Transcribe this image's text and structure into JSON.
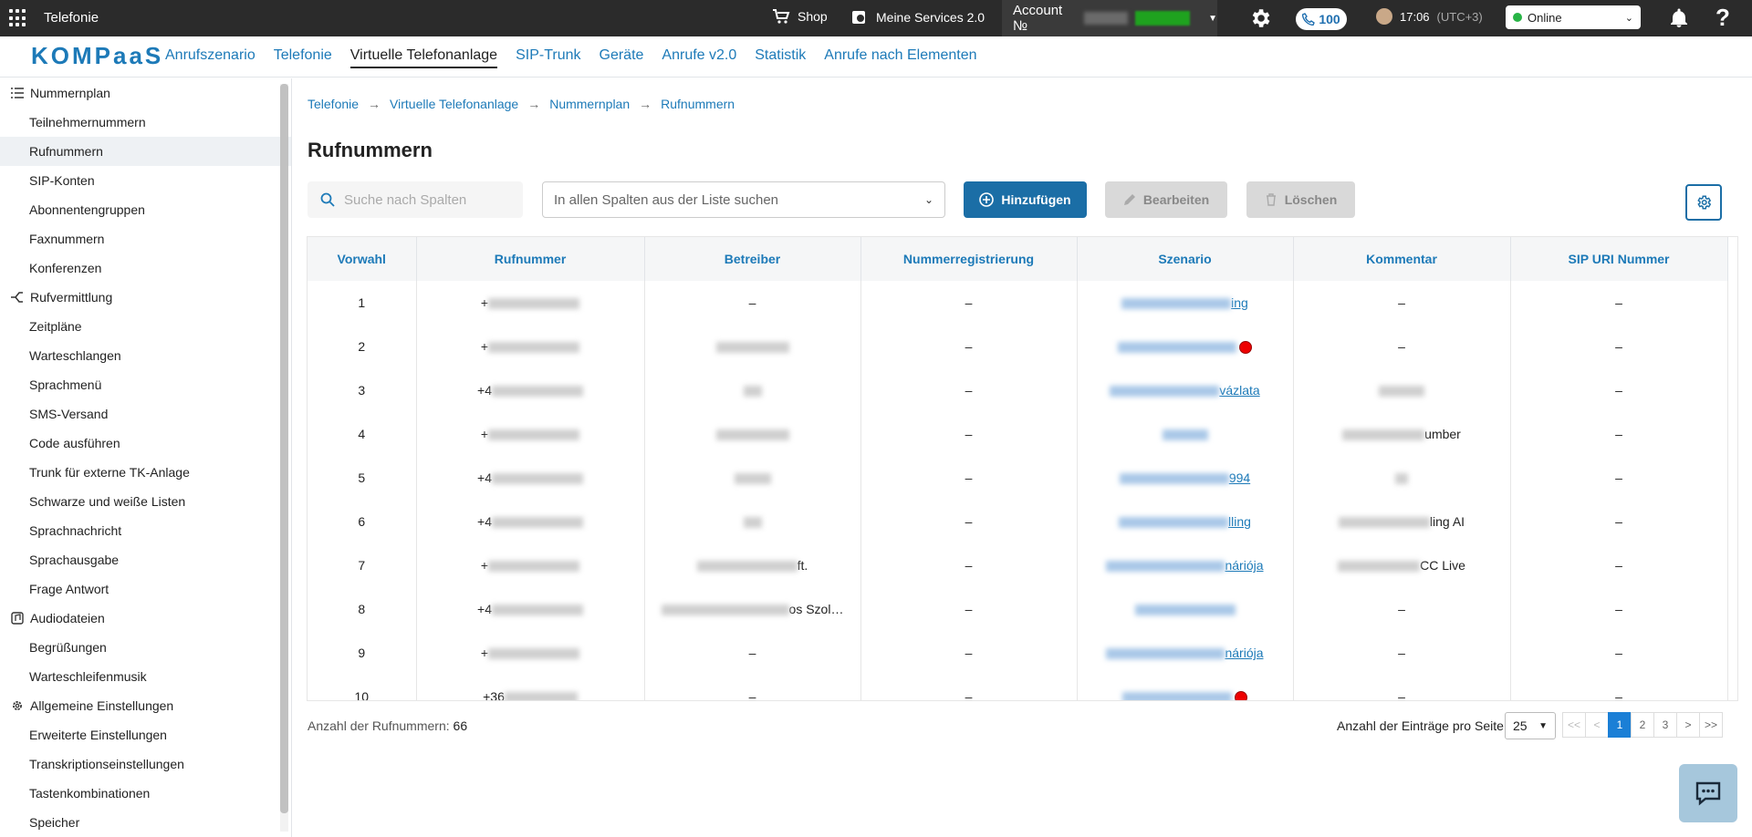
{
  "topbar": {
    "app_title": "Telefonie",
    "shop_label": "Shop",
    "services_label": "Meine Services 2.0",
    "account_label": "Account №",
    "calls_count": "100",
    "time": "17:06",
    "timezone": "(UTC+3)",
    "status": "Online",
    "help": "?"
  },
  "nav": {
    "logo": "KOMPaaS",
    "items": [
      "Anrufszenario",
      "Telefonie",
      "Virtuelle Telefonanlage",
      "SIP-Trunk",
      "Geräte",
      "Anrufe v2.0",
      "Statistik",
      "Anrufe nach Elementen"
    ],
    "active": "Virtuelle Telefonanlage"
  },
  "sidebar": {
    "groups": [
      {
        "label": "Nummernplan",
        "items": [
          "Teilnehmernummern",
          "Rufnummern",
          "SIP-Konten",
          "Abonnentengruppen",
          "Faxnummern",
          "Konferenzen"
        ]
      },
      {
        "label": "Rufvermittlung",
        "items": [
          "Zeitpläne",
          "Warteschlangen",
          "Sprachmenü",
          "SMS-Versand",
          "Code ausführen",
          "Trunk für externe TK-Anlage",
          "Schwarze und weiße Listen",
          "Sprachnachricht",
          "Sprachausgabe",
          "Frage Antwort"
        ]
      },
      {
        "label": "Audiodateien",
        "items": [
          "Begrüßungen",
          "Warteschleifenmusik"
        ]
      },
      {
        "label": "Allgemeine Einstellungen",
        "items": [
          "Erweiterte Einstellungen",
          "Transkriptionseinstellungen",
          "Tastenkombinationen",
          "Speicher"
        ]
      }
    ],
    "active_item": "Rufnummern"
  },
  "breadcrumb": [
    "Telefonie",
    "Virtuelle Telefonanlage",
    "Nummernplan",
    "Rufnummern"
  ],
  "page_title": "Rufnummern",
  "toolbar": {
    "search_placeholder": "Suche nach Spalten",
    "filter_value": "In allen Spalten aus der Liste suchen",
    "add_label": "Hinzufügen",
    "edit_label": "Bearbeiten",
    "delete_label": "Löschen"
  },
  "table": {
    "columns": [
      "Vorwahl",
      "Rufnummer",
      "Betreiber",
      "Nummerregistrierung",
      "Szenario",
      "Kommentar",
      "SIP URI Nummer"
    ],
    "rows": [
      {
        "vorwahl": "1",
        "rufnummer": "+",
        "betreiber": "–",
        "reg": "–",
        "szenario": "ing",
        "kommentar": "–",
        "sip": "–"
      },
      {
        "vorwahl": "2",
        "rufnummer": "+",
        "betreiber": "",
        "reg": "–",
        "szenario": "",
        "kommentar": "–",
        "sip": "–"
      },
      {
        "vorwahl": "3",
        "rufnummer": "+4",
        "betreiber": "",
        "reg": "–",
        "szenario": "vázlata",
        "kommentar": "",
        "sip": "–"
      },
      {
        "vorwahl": "4",
        "rufnummer": "+",
        "betreiber": "",
        "reg": "–",
        "szenario": "",
        "kommentar": "umber",
        "sip": "–"
      },
      {
        "vorwahl": "5",
        "rufnummer": "+4",
        "betreiber": "",
        "reg": "–",
        "szenario": "994",
        "kommentar": "",
        "sip": "–"
      },
      {
        "vorwahl": "6",
        "rufnummer": "+4",
        "betreiber": "",
        "reg": "–",
        "szenario": "lling",
        "kommentar": "ling AI",
        "sip": "–"
      },
      {
        "vorwahl": "7",
        "rufnummer": "+",
        "betreiber": "ft.",
        "reg": "–",
        "szenario": "náriója",
        "kommentar": "CC Live",
        "sip": "–"
      },
      {
        "vorwahl": "8",
        "rufnummer": "+4",
        "betreiber": "os Szol…",
        "reg": "–",
        "szenario": "",
        "kommentar": "–",
        "sip": "–"
      },
      {
        "vorwahl": "9",
        "rufnummer": "+",
        "betreiber": "–",
        "reg": "–",
        "szenario": "náriója",
        "kommentar": "–",
        "sip": "–"
      },
      {
        "vorwahl": "10",
        "rufnummer": "+36",
        "betreiber": "–",
        "reg": "–",
        "szenario": "",
        "kommentar": "–",
        "sip": "–"
      }
    ]
  },
  "footer": {
    "count_label": "Anzahl der Rufnummern:",
    "count_value": "66",
    "perpage_label": "Anzahl der Einträge pro Seite",
    "perpage_value": "25",
    "pages": [
      "<<",
      "<",
      "1",
      "2",
      "3",
      ">",
      ">>"
    ]
  }
}
